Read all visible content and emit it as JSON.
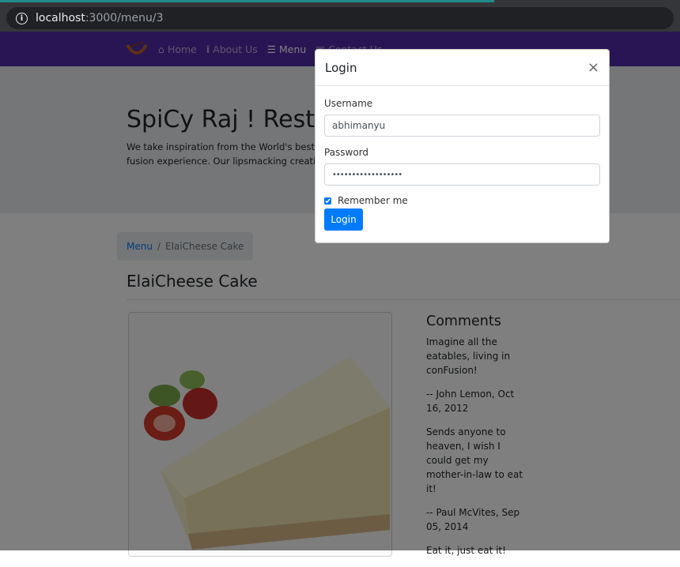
{
  "browser": {
    "host": "localhost",
    "path": ":3000/menu/3"
  },
  "nav": {
    "items": [
      {
        "label": "Home",
        "icon": "home-icon"
      },
      {
        "label": "About Us",
        "icon": "info-icon"
      },
      {
        "label": "Menu",
        "icon": "list-icon",
        "active": true
      },
      {
        "label": "Contact Us",
        "icon": "address-card-icon"
      }
    ]
  },
  "jumbotron": {
    "title": "SpiCy Raj ! Restar",
    "line1": "We take inspiration from the World's best cui",
    "line2": "fusion experience. Our lipsmacking creations"
  },
  "breadcrumb": {
    "link": "Menu",
    "sep": "/",
    "current": "ElaiCheese Cake"
  },
  "dish": {
    "title": "ElaiCheese Cake"
  },
  "comments": {
    "heading": "Comments",
    "items": [
      {
        "text": "Imagine all the eatables, living in conFusion!",
        "author": "-- John Lemon, Oct 16, 2012"
      },
      {
        "text": "Sends anyone to heaven, I wish I could get my mother-in-law to eat it!",
        "author": "-- Paul McVites, Sep 05, 2014"
      },
      {
        "text": "Eat it, just eat it!"
      }
    ]
  },
  "modal": {
    "title": "Login",
    "close": "×",
    "username_label": "Username",
    "username_value": "abhimanyu",
    "password_label": "Password",
    "password_value": "••••••••••••••••••",
    "remember_label": "Remember me",
    "remember_checked": true,
    "submit": "Login"
  },
  "colors": {
    "navbar": "#512da8",
    "primary": "#007bff"
  }
}
